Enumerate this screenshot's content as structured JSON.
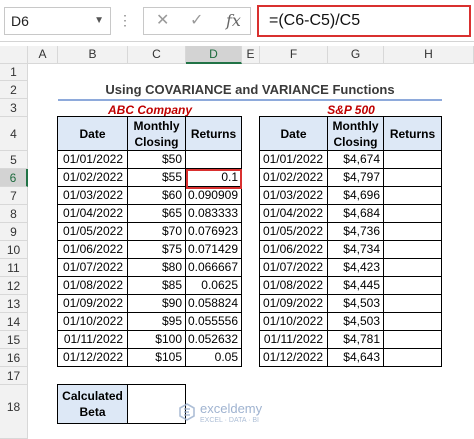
{
  "formula_bar": {
    "name_box": "D6",
    "cancel_glyph": "✕",
    "enter_glyph": "✓",
    "fx_label": "fx",
    "formula": "=(C6-C5)/C5"
  },
  "columns": [
    "A",
    "B",
    "C",
    "D",
    "E",
    "F",
    "G",
    "H"
  ],
  "selected_column": "D",
  "rows": [
    "1",
    "2",
    "3",
    "4",
    "5",
    "6",
    "7",
    "8",
    "9",
    "10",
    "11",
    "12",
    "13",
    "14",
    "15",
    "16",
    "17",
    "18"
  ],
  "selected_row": "6",
  "sheet": {
    "title": "Using COVARIANCE and VARIANCE Functions",
    "left_table": {
      "caption": "ABC Company",
      "headers": [
        "Date",
        "Monthly Closing",
        "Returns"
      ],
      "rows": [
        {
          "date": "01/01/2022",
          "close": "$50",
          "ret": ""
        },
        {
          "date": "01/02/2022",
          "close": "$55",
          "ret": "0.1"
        },
        {
          "date": "01/03/2022",
          "close": "$60",
          "ret": "0.090909"
        },
        {
          "date": "01/04/2022",
          "close": "$65",
          "ret": "0.083333"
        },
        {
          "date": "01/05/2022",
          "close": "$70",
          "ret": "0.076923"
        },
        {
          "date": "01/06/2022",
          "close": "$75",
          "ret": "0.071429"
        },
        {
          "date": "01/07/2022",
          "close": "$80",
          "ret": "0.066667"
        },
        {
          "date": "01/08/2022",
          "close": "$85",
          "ret": "0.0625"
        },
        {
          "date": "01/09/2022",
          "close": "$90",
          "ret": "0.058824"
        },
        {
          "date": "01/10/2022",
          "close": "$95",
          "ret": "0.055556"
        },
        {
          "date": "01/11/2022",
          "close": "$100",
          "ret": "0.052632"
        },
        {
          "date": "01/12/2022",
          "close": "$105",
          "ret": "0.05"
        }
      ]
    },
    "right_table": {
      "caption": "S&P 500",
      "headers": [
        "Date",
        "Monthly Closing",
        "Returns"
      ],
      "rows": [
        {
          "date": "01/01/2022",
          "close": "$4,674",
          "ret": ""
        },
        {
          "date": "01/02/2022",
          "close": "$4,797",
          "ret": ""
        },
        {
          "date": "01/03/2022",
          "close": "$4,696",
          "ret": ""
        },
        {
          "date": "01/04/2022",
          "close": "$4,684",
          "ret": ""
        },
        {
          "date": "01/05/2022",
          "close": "$4,736",
          "ret": ""
        },
        {
          "date": "01/06/2022",
          "close": "$4,734",
          "ret": ""
        },
        {
          "date": "01/07/2022",
          "close": "$4,423",
          "ret": ""
        },
        {
          "date": "01/08/2022",
          "close": "$4,445",
          "ret": ""
        },
        {
          "date": "01/09/2022",
          "close": "$4,503",
          "ret": ""
        },
        {
          "date": "01/10/2022",
          "close": "$4,503",
          "ret": ""
        },
        {
          "date": "01/11/2022",
          "close": "$4,781",
          "ret": ""
        },
        {
          "date": "01/12/2022",
          "close": "$4,643",
          "ret": ""
        }
      ]
    },
    "beta": {
      "label": "Calculated Beta",
      "value": ""
    }
  },
  "watermark": {
    "name": "exceldemy",
    "tagline": "EXCEL · DATA · BI"
  }
}
